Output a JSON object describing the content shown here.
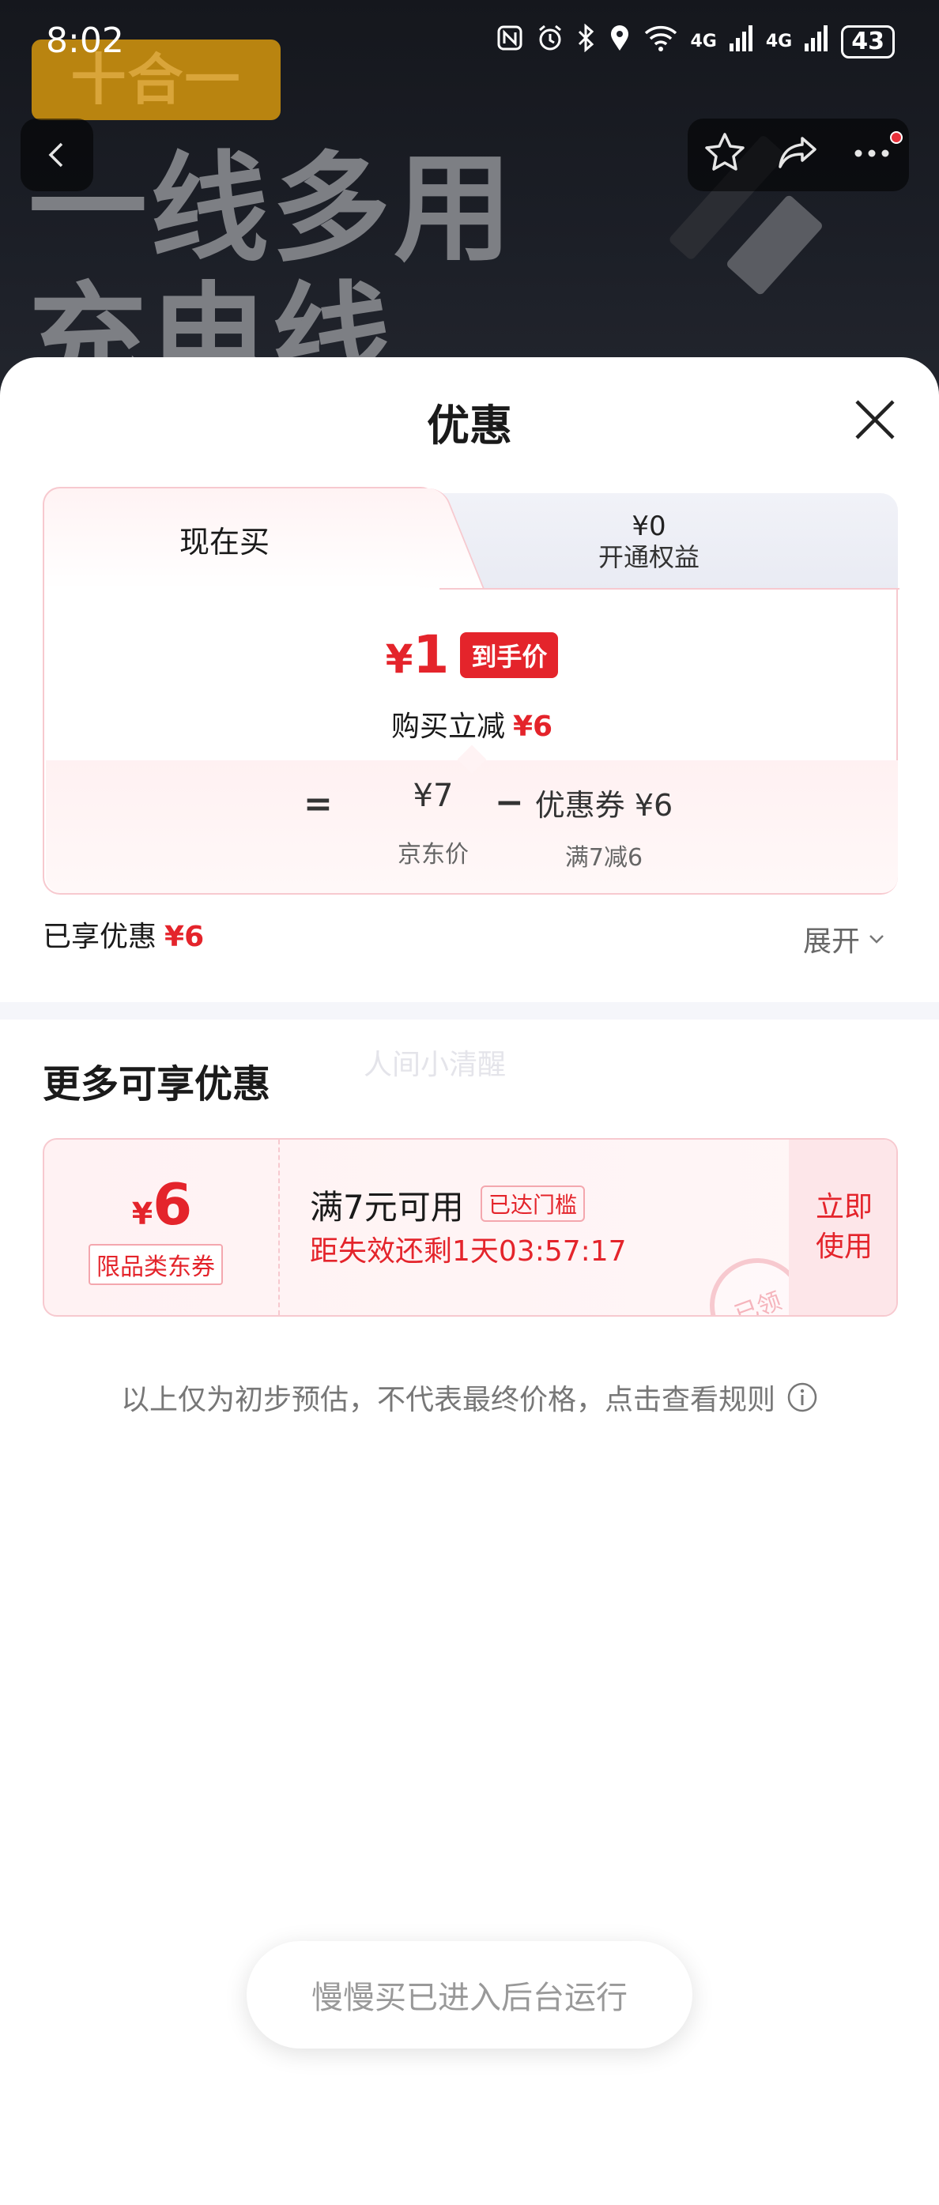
{
  "status_bar": {
    "time": "8:02",
    "network_1": "4G",
    "network_2": "4G",
    "battery": "43"
  },
  "background": {
    "badge": "十合一",
    "headline_1": "一线多用",
    "headline_2": "充电线"
  },
  "nav": {
    "icons": [
      "back-icon",
      "star-icon",
      "share-icon",
      "more-icon"
    ]
  },
  "sheet": {
    "title": "优惠",
    "tabs": {
      "buy_now": "现在买",
      "membership_price": "¥0",
      "membership_label": "开通权益"
    },
    "final_price": {
      "currency": "¥",
      "amount": "1",
      "tag": "到手价"
    },
    "reduce": {
      "label": "购买立减",
      "amount": "¥6"
    },
    "calc": {
      "equals": "=",
      "jd_price": "¥7",
      "jd_label": "京东价",
      "minus": "−",
      "coupon": "优惠券 ¥6",
      "coupon_sub": "满7减6"
    },
    "enjoyed": {
      "label": "已享优惠",
      "amount": "¥6"
    },
    "expand": "展开",
    "more_title": "更多可享优惠",
    "watermark": "人间小清醒",
    "coupon_card": {
      "currency": "¥",
      "value": "6",
      "type": "限品类东券",
      "condition": "满7元可用",
      "status_chip": "已达门槛",
      "expire": "距失效还剩1天03:57:17",
      "use_button": "立即使用",
      "stamp": "已领"
    },
    "disclaimer": "以上仅为初步预估，不代表最终价格，点击查看规则",
    "toast": "慢慢买已进入后台运行"
  },
  "colors": {
    "accent_red": "#e4242b",
    "border_pink": "#f7c9cf"
  }
}
